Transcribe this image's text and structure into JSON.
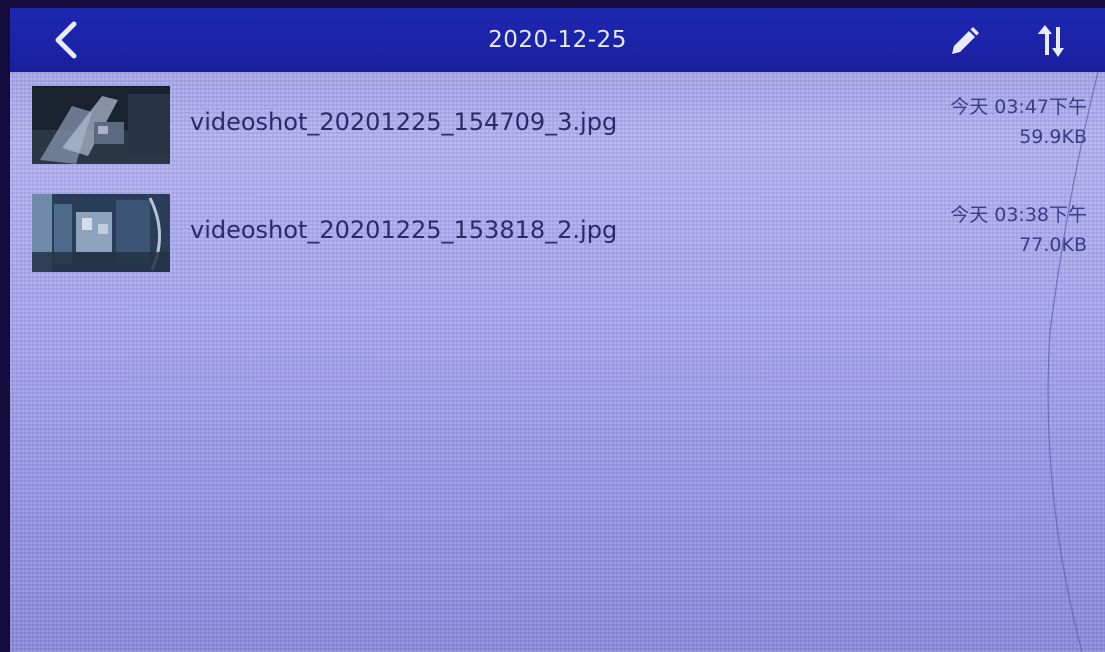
{
  "header": {
    "title": "2020-12-25",
    "back_icon": "chevron-left-icon",
    "edit_icon": "pencil-icon",
    "sort_icon": "sort-arrows-icon"
  },
  "files": [
    {
      "name": "videoshot_20201225_154709_3.jpg",
      "time": "今天 03:47下午",
      "size": "59.9KB",
      "thumbnail_icon": "image-thumbnail-icon"
    },
    {
      "name": "videoshot_20201225_153818_2.jpg",
      "time": "今天 03:38下午",
      "size": "77.0KB",
      "thumbnail_icon": "image-thumbnail-icon"
    }
  ],
  "colors": {
    "header_bg": "#1c27b0",
    "list_bg": "#aeadee",
    "text": "#2a2a66"
  }
}
